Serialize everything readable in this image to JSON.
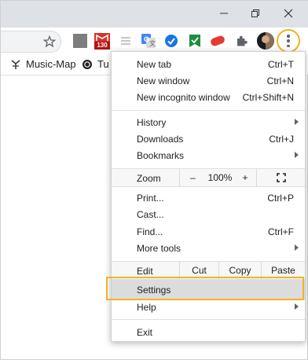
{
  "window_controls": {
    "minimize": "minimize",
    "restore": "restore",
    "close": "close"
  },
  "toolbar": {
    "bookmark_star": "star-icon",
    "extensions": [
      {
        "name": "grey-square-extension",
        "color": "#7d7d7d"
      },
      {
        "name": "gmail-extension",
        "badge": "130",
        "color": "#d93025"
      },
      {
        "name": "stack-extension",
        "color": "#c5c5c5"
      },
      {
        "name": "translate-extension",
        "color": "#4285f4"
      },
      {
        "name": "blue-check-extension",
        "color": "#1a73e8"
      },
      {
        "name": "green-flag-extension",
        "color": "#1e8e3e"
      },
      {
        "name": "red-pill-extension",
        "color": "#e53935"
      },
      {
        "name": "puzzle-extensions",
        "color": "#5f6368"
      },
      {
        "name": "profile-avatar",
        "color": "#3a3a3a"
      }
    ],
    "menu_button": "kebab-icon"
  },
  "bookmarks": [
    {
      "label": "Music-Map",
      "icon": "music-map-icon"
    },
    {
      "label": "Tu",
      "icon": "spiral-icon"
    }
  ],
  "menu": {
    "items_top": [
      {
        "label": "New tab",
        "shortcut": "Ctrl+T"
      },
      {
        "label": "New window",
        "shortcut": "Ctrl+N"
      },
      {
        "label": "New incognito window",
        "shortcut": "Ctrl+Shift+N"
      }
    ],
    "items_history": [
      {
        "label": "History",
        "shortcut": "",
        "submenu": true
      },
      {
        "label": "Downloads",
        "shortcut": "Ctrl+J",
        "submenu": false
      },
      {
        "label": "Bookmarks",
        "shortcut": "",
        "submenu": true
      }
    ],
    "zoom": {
      "label": "Zoom",
      "minus": "–",
      "value": "100%",
      "plus": "+",
      "fullscreen": "fullscreen-icon"
    },
    "items_tools": [
      {
        "label": "Print...",
        "shortcut": "Ctrl+P"
      },
      {
        "label": "Cast...",
        "shortcut": ""
      },
      {
        "label": "Find...",
        "shortcut": "Ctrl+F"
      },
      {
        "label": "More tools",
        "shortcut": "",
        "submenu": true
      }
    ],
    "edit": {
      "label": "Edit",
      "cut": "Cut",
      "copy": "Copy",
      "paste": "Paste"
    },
    "settings": "Settings",
    "help": "Help",
    "exit": "Exit"
  },
  "highlight_color": "#f0b323"
}
